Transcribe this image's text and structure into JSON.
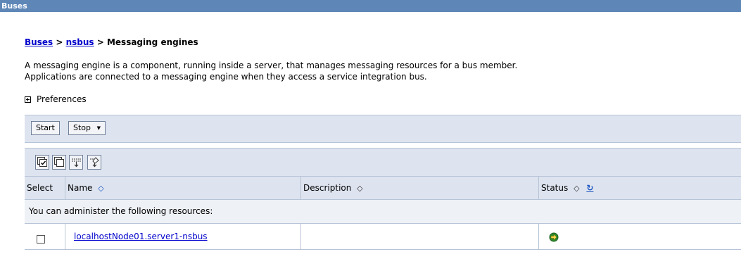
{
  "title_bar": {
    "text": "Buses"
  },
  "breadcrumb": {
    "items": [
      {
        "label": "Buses",
        "link": true
      },
      {
        "label": "nsbus",
        "link": true
      },
      {
        "label": "Messaging engines",
        "link": false
      }
    ],
    "separator": ">"
  },
  "description": {
    "line1": "A messaging engine is a component, running inside a server, that manages messaging resources for a bus member.",
    "line2": "Applications are connected to a messaging engine when they access a service integration bus."
  },
  "preferences": {
    "label": "Preferences",
    "icon": "expand-plus-icon"
  },
  "toolbar": {
    "start_label": "Start",
    "stop_label": "Stop",
    "stop_menu_icon": "▼"
  },
  "icon_toolbar": [
    {
      "name": "select-all-icon"
    },
    {
      "name": "deselect-all-icon"
    },
    {
      "name": "show-filter-icon"
    },
    {
      "name": "clear-filter-icon"
    }
  ],
  "table": {
    "columns": [
      {
        "label": "Select"
      },
      {
        "label": "Name",
        "sort": "◇"
      },
      {
        "label": "Description",
        "sort": "◇"
      },
      {
        "label": "Status",
        "sort": "◇",
        "refresh": "↻"
      }
    ],
    "notice": "You can administer the following resources:",
    "rows": [
      {
        "name": "localhostNode01.server1-nsbus",
        "description": "",
        "status_icon": "started-arrow-icon",
        "status_color": "#2e8b2e"
      }
    ]
  }
}
